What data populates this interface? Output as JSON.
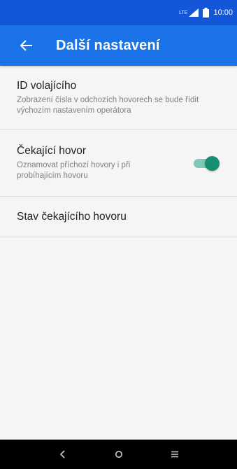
{
  "status_bar": {
    "network_label": "LTE",
    "time": "10:00"
  },
  "app_bar": {
    "title": "Další nastavení",
    "back_icon": "arrow-left-icon"
  },
  "settings": [
    {
      "title": "ID volajícího",
      "summary": "Zobrazení čísla v odchozích hovorech se bude řídit výchozím nastavením operátora"
    },
    {
      "title": "Čekající hovor",
      "summary": "Oznamovat příchozí hovory i při probíhajícím hovoru",
      "toggle_on": true
    },
    {
      "title": "Stav čekajícího hovoru"
    }
  ],
  "colors": {
    "status_bar": "#1456d8",
    "app_bar": "#1a73e8",
    "toggle_thumb": "#178e73",
    "toggle_track": "#7ec8b7"
  },
  "nav_bar": {
    "icons": [
      "back-nav-icon",
      "home-nav-icon",
      "recents-nav-icon"
    ]
  }
}
